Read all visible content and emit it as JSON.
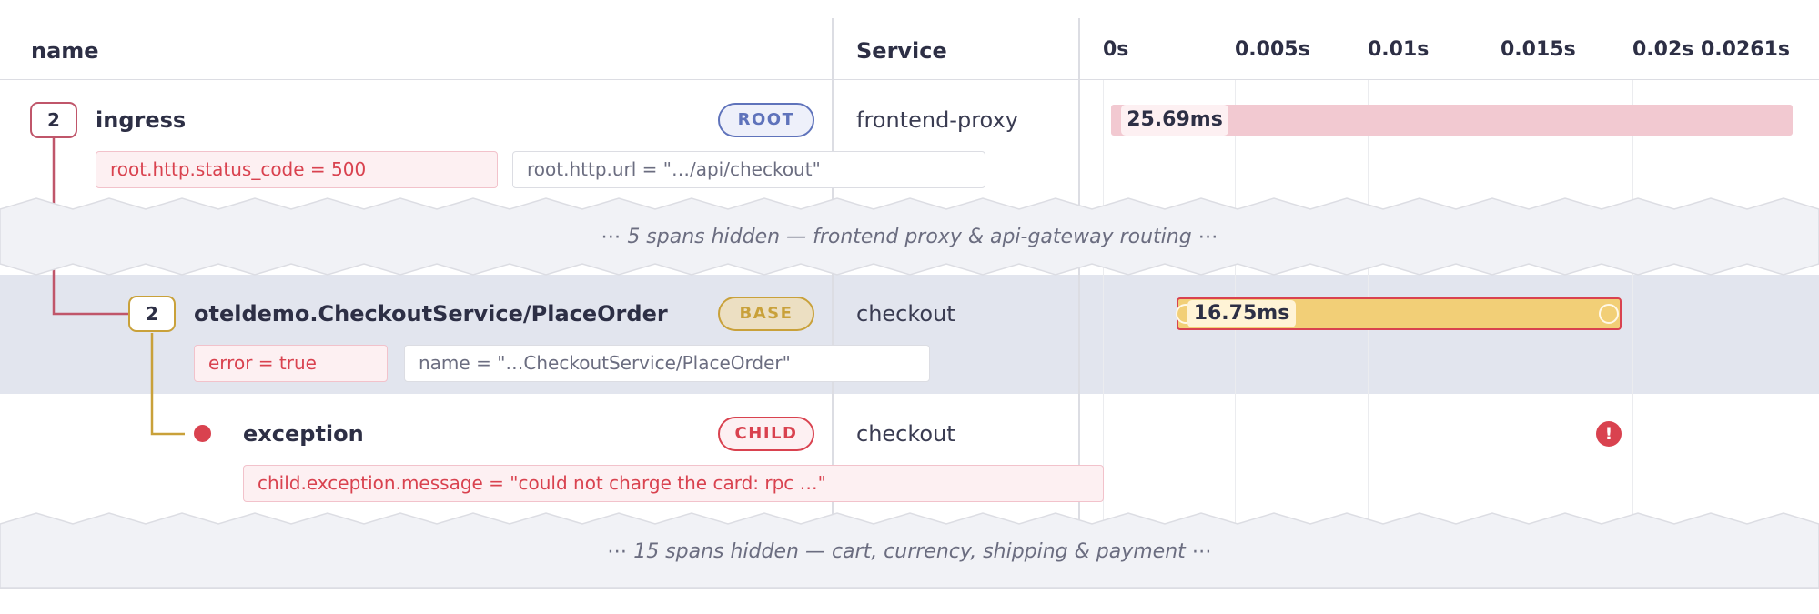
{
  "header": {
    "name_col": "name",
    "service_col": "Service",
    "ticks": [
      "0s",
      "0.005s",
      "0.01s",
      "0.015s",
      "0.02s",
      "0.0261s"
    ]
  },
  "rows": {
    "root": {
      "count": "2",
      "name": "ingress",
      "role": "ROOT",
      "service": "frontend-proxy",
      "duration": "25.69ms",
      "attrs": [
        "root.http.status_code = 500",
        "root.http.url = \"…/api/checkout\""
      ]
    },
    "base": {
      "count": "2",
      "name": "oteldemo.CheckoutService/PlaceOrder",
      "role": "BASE",
      "service": "checkout",
      "duration": "16.75ms",
      "attrs": [
        "error = true",
        "name = \"…CheckoutService/PlaceOrder\""
      ]
    },
    "child": {
      "name": "exception",
      "role": "CHILD",
      "service": "checkout",
      "attrs": [
        "child.exception.message = \"could not charge the card: rpc …\""
      ],
      "error_icon": "!"
    }
  },
  "hidden": {
    "first": "⋯  5 spans hidden — frontend proxy & api-gateway routing  ⋯",
    "second": "⋯  15 spans hidden — cart, currency, shipping & payment  ⋯"
  },
  "colors": {
    "root": "#c0566a",
    "base": "#c9a13a",
    "child": "#d9424f",
    "root_bar": "#f2c9d1",
    "base_bar": "#f2cf77",
    "root_pill": "#5f73bb",
    "hidden_band": "#f1f2f6"
  }
}
